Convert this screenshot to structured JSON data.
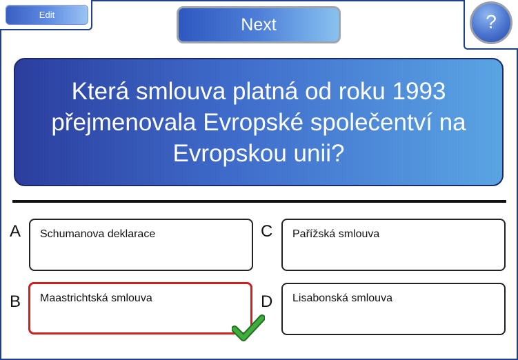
{
  "toolbar": {
    "edit_label": "Edit",
    "next_label": "Next",
    "help_label": "?"
  },
  "question": {
    "text": "Která smlouva platná od roku 1993 přejmenovala Evropské společentví na Evropskou unii?"
  },
  "answers": [
    {
      "letter": "A",
      "text": "Schumanova deklarace",
      "correct": false
    },
    {
      "letter": "B",
      "text": "Maastrichtská smlouva",
      "correct": true
    },
    {
      "letter": "C",
      "text": "Pařížská smlouva",
      "correct": false
    },
    {
      "letter": "D",
      "text": "Lisabonská smlouva",
      "correct": false
    }
  ],
  "colors": {
    "accent_blue": "#3f6ccb",
    "correct_border": "#cf1f1f",
    "checkmark": "#2e9b2e"
  },
  "icons": {
    "correct_marker": "check-icon"
  }
}
